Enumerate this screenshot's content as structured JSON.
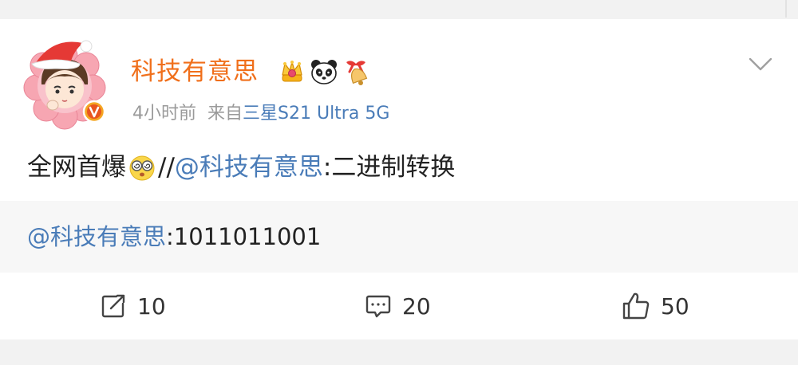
{
  "post": {
    "user_name": "科技有意思",
    "time": "4小时前",
    "source_prefix": "来自",
    "device": "三星S21 Ultra 5G",
    "text_before": "全网首爆",
    "repost_slashes": "//",
    "mention": "@科技有意思",
    "text_after": ":二进制转换",
    "badges": [
      "crown-badge-icon",
      "panda-badge-icon",
      "bell-badge-icon"
    ]
  },
  "quoted": {
    "mention": "@科技有意思",
    "text": ":1011011001"
  },
  "actions": {
    "repost_count": "10",
    "comment_count": "20",
    "like_count": "50"
  },
  "colors": {
    "user_name": "#f06f1b",
    "link": "#4a7cb8",
    "meta": "#9a9a9a",
    "quote_bg": "#f7f7f7"
  }
}
